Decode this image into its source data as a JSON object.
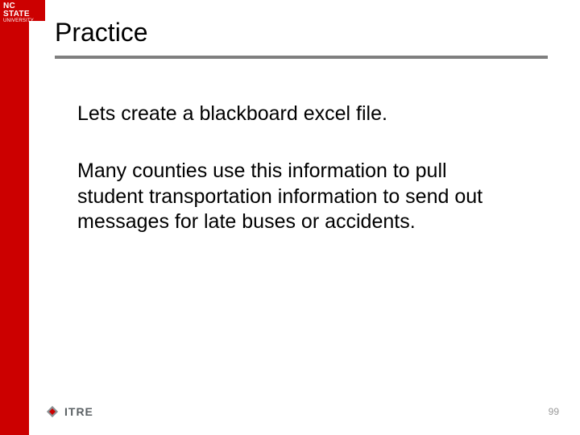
{
  "brand": {
    "primary_line": "NC STATE",
    "secondary_line": "UNIVERSITY",
    "footer_logo_text": "ITRE"
  },
  "colors": {
    "accent": "#cc0000",
    "rule": "#7f7f7f",
    "footer_gray": "#5b6164"
  },
  "slide": {
    "title": "Practice",
    "paragraph1": "Lets create a blackboard excel file.",
    "paragraph2": "Many counties use this information to pull student transportation information to send out messages for late buses or accidents.",
    "page_number": "99"
  }
}
